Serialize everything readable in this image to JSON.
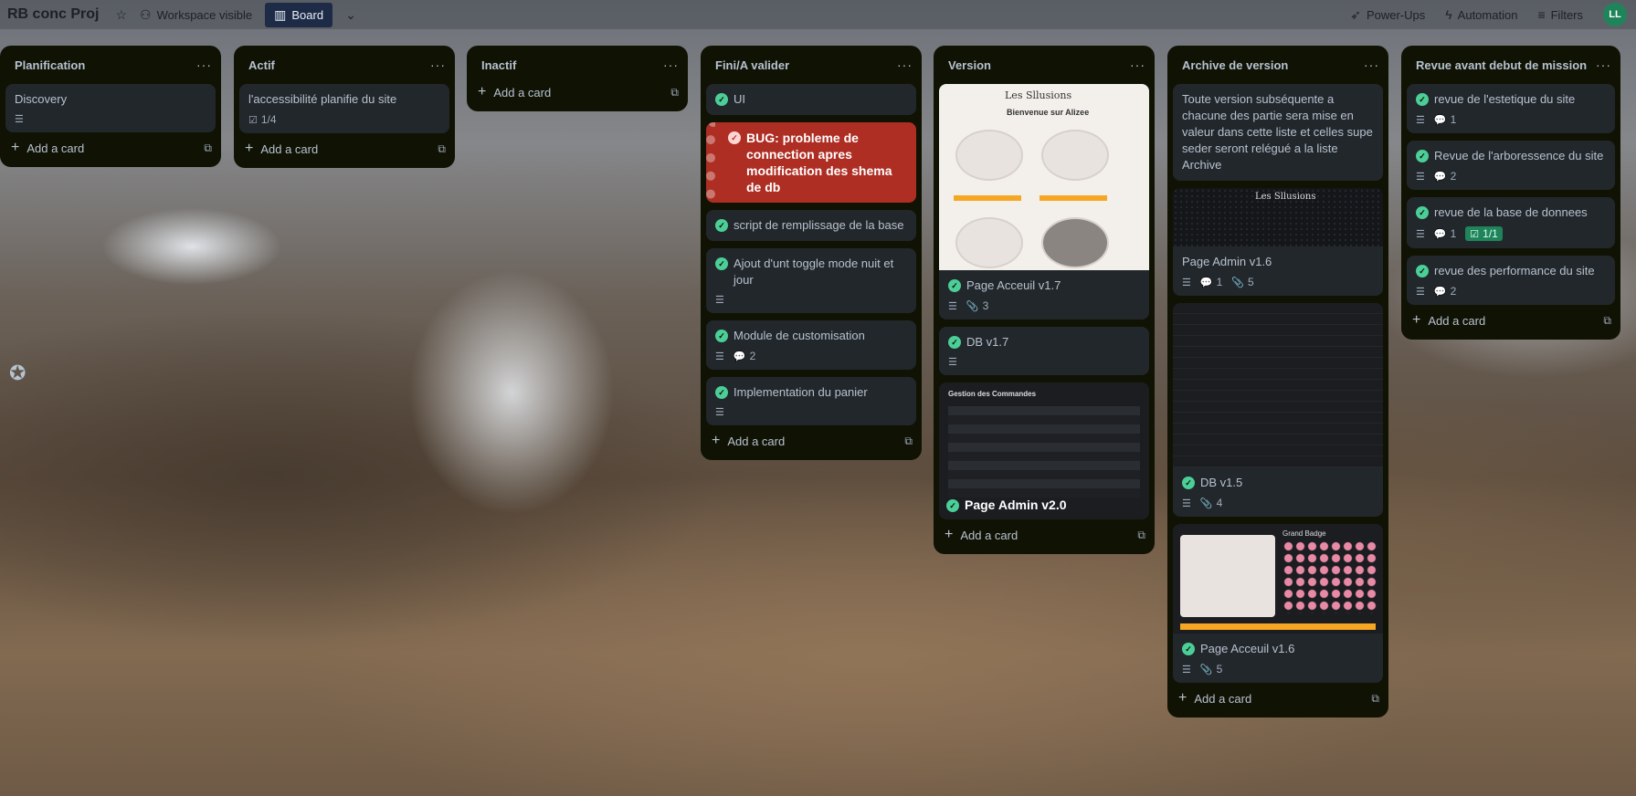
{
  "topbar": {
    "board_title": "RB conc Proj",
    "workspace_visible": "Workspace visible",
    "board": "Board",
    "power_ups": "Power-Ups",
    "automation": "Automation",
    "filters": "Filters",
    "avatar_initials": "LL"
  },
  "add_card_label": "Add a card",
  "lists": [
    {
      "title": "Planification",
      "cards": [
        {
          "title": "Discovery"
        }
      ]
    },
    {
      "title": "Actif",
      "cards": [
        {
          "title": "l'accessibilité planifie du site",
          "checklist": "1/4"
        }
      ]
    },
    {
      "title": "Inactif",
      "cards": []
    },
    {
      "title": "Fini/A valider",
      "cards": [
        {
          "title": "UI"
        },
        {
          "title": "BUG: probleme de connection apres modification des shema de db"
        },
        {
          "title": "script de remplissage de la base"
        },
        {
          "title": "Ajout d'unt toggle mode nuit et jour"
        },
        {
          "title": "Module de customisation",
          "comments": "2"
        },
        {
          "title": "Implementation du panier"
        }
      ]
    },
    {
      "title": "Version",
      "cards": [
        {
          "title": "Page Acceuil v1.7",
          "attachments": "3",
          "cover_text": "Bienvenue sur Alizee",
          "cover_logo": "Les Sllusions"
        },
        {
          "title": "DB v1.7"
        },
        {
          "title": "Page Admin v2.0",
          "cover_text": "Gestion des Commandes"
        }
      ]
    },
    {
      "title": "Archive de version",
      "cards": [
        {
          "title": "Toute version subséquente a chacune des partie sera mise en valeur dans cette liste et celles supe seder seront relégué a la liste Archive"
        },
        {
          "title": "Page Admin v1.6",
          "comments": "1",
          "attachments": "5",
          "cover_logo": "Les Sllusions"
        },
        {
          "title": "DB v1.5",
          "attachments": "4"
        },
        {
          "title": "Page Acceuil v1.6",
          "attachments": "5",
          "cover_text": "Grand Badge"
        }
      ]
    },
    {
      "title": "Revue avant debut de mission",
      "cards": [
        {
          "title": "revue de l'estetique du site",
          "comments": "1"
        },
        {
          "title": "Revue de l'arboressence du site",
          "comments": "2"
        },
        {
          "title": "revue de la base de donnees",
          "comments": "1",
          "checklist": "1/1"
        },
        {
          "title": "revue des performance du site",
          "comments": "2"
        }
      ]
    }
  ],
  "colors": {
    "list_bg": "#101204",
    "card_bg": "#22272b",
    "bug_red": "#ae2e24",
    "check_green": "#4bce97"
  }
}
